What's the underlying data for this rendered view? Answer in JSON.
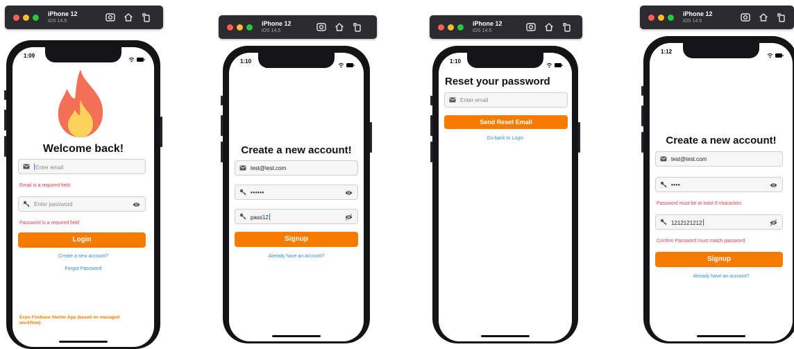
{
  "toolbar": {
    "device_name": "iPhone 12",
    "os_version": "iOS 14.5",
    "icons": [
      "screenshot-icon",
      "home-icon",
      "rotate-icon"
    ]
  },
  "colors": {
    "accent": "#f57c00",
    "error": "#e8394a",
    "link": "#2f8fdb",
    "toolbar_bg": "#2b2b30"
  },
  "screens": [
    {
      "time": "1:09",
      "title": "Welcome back!",
      "email_placeholder": "Enter email",
      "email_error": "Email is a required field",
      "password_placeholder": "Enter password",
      "password_error": "Password is a required field",
      "button": "Login",
      "link_signup": "Create a new account?",
      "link_forgot": "Forgot Password",
      "footer": "Expo Firebase Starter App (based on managed workflow)"
    },
    {
      "time": "1:10",
      "title": "Create a new account!",
      "email_value": "test@test.com",
      "password_value": "••••••",
      "confirm_value": "pass12",
      "button": "Signup",
      "link_login": "Already have an account?"
    },
    {
      "time": "1:10",
      "title": "Reset your password",
      "email_placeholder": "Enter email",
      "button": "Send Reset Email",
      "link_back": "Go back to Login"
    },
    {
      "time": "1:12",
      "title": "Create a new account!",
      "email_value": "test@test.com",
      "password_value": "••••",
      "password_error": "Password must be at least 6 characters",
      "confirm_value": "1212121212",
      "confirm_error": "Confirm Password must match password.",
      "button": "Signup",
      "link_login": "Already have an account?"
    }
  ]
}
